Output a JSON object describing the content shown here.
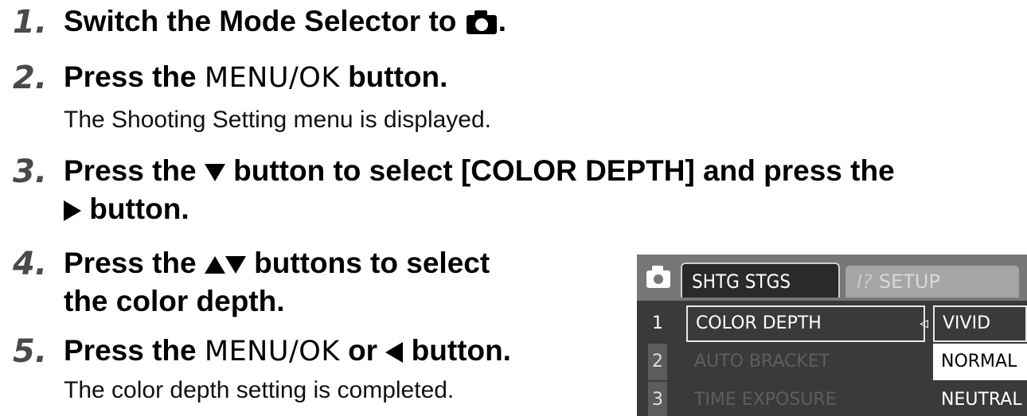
{
  "steps": [
    {
      "num": "1.",
      "text_a": "Switch the Mode Selector to",
      "text_b": "."
    },
    {
      "num": "2.",
      "text_a": "Press the",
      "button": "MENU/OK",
      "text_b": "button.",
      "desc": "The Shooting Setting menu is displayed."
    },
    {
      "num": "3.",
      "text_a": "Press the",
      "text_b": "button to select [COLOR DEPTH] and press the",
      "text_c": "button."
    },
    {
      "num": "4.",
      "text_a": "Press the",
      "text_b": "buttons to select",
      "text_c": "the color depth."
    },
    {
      "num": "5.",
      "text_a": "Press the",
      "button": "MENU/OK",
      "text_b": "or",
      "text_c": "button.",
      "desc": "The color depth setting is completed."
    }
  ],
  "icons": {
    "camera": "camera-icon",
    "down": "down-triangle-icon",
    "up": "up-triangle-icon",
    "right": "right-triangle-icon",
    "left": "left-triangle-icon"
  },
  "lcd": {
    "tab_active": "SHTG STGS",
    "tab_inactive_icon": "I?",
    "tab_inactive": "SETUP",
    "rows": [
      {
        "num": "1",
        "label": "COLOR DEPTH",
        "option": "VIVID"
      },
      {
        "num": "2",
        "label": "AUTO BRACKET",
        "option": "NORMAL"
      },
      {
        "num": "3",
        "label": "TIME EXPOSURE",
        "option": "NEUTRAL"
      }
    ],
    "colors": {
      "background": "#3a3a3a",
      "tabbar": "#777777",
      "highlight": "#ffffff"
    }
  }
}
